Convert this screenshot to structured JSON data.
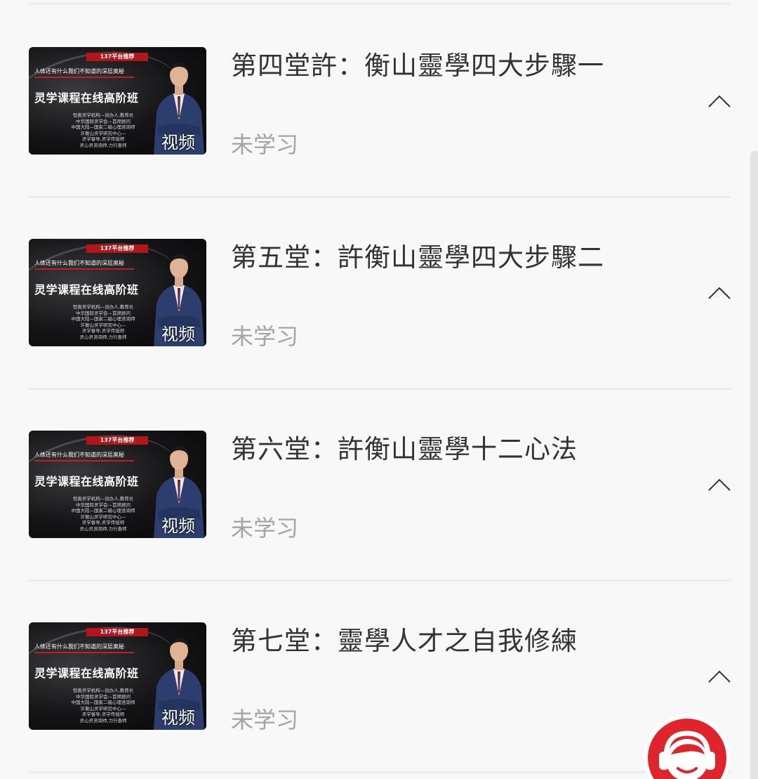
{
  "lessons": [
    {
      "title": "第四堂許：衡山靈學四大步驟一",
      "status": "未学习",
      "thumbnail": {
        "badge": "137平台推荐",
        "tagline": "人体还有什么我们不知道的深层奥秘",
        "heading": "灵学课程在线高阶班",
        "credits": [
          "恒善灵学机构—创办人,教育长",
          "中华国际灵学会—首席顾问",
          "中国大陆—国家二级心理咨询师",
          "许衡山灵学研究中心—",
          "灵学督导,灵学传授师",
          "灵心灵咨询师,力行查师"
        ],
        "media_label": "视频"
      }
    },
    {
      "title": "第五堂：許衡山靈學四大步驟二",
      "status": "未学习",
      "thumbnail": {
        "badge": "137平台推荐",
        "tagline": "人体还有什么我们不知道的深层奥秘",
        "heading": "灵学课程在线高阶班",
        "credits": [
          "恒善灵学机构—创办人,教育长",
          "中华国际灵学会—首席顾问",
          "中国大陆—国家二级心理咨询师",
          "许衡山灵学研究中心—",
          "灵学督导,灵学传授师",
          "灵心灵咨询师,力行查师"
        ],
        "media_label": "视频"
      }
    },
    {
      "title": "第六堂：許衡山靈學十二心法",
      "status": "未学习",
      "thumbnail": {
        "badge": "137平台推荐",
        "tagline": "人体还有什么我们不知道的深层奥秘",
        "heading": "灵学课程在线高阶班",
        "credits": [
          "恒善灵学机构—创办人,教育长",
          "中华国际灵学会—首席顾问",
          "中国大陆—国家二级心理咨询师",
          "许衡山灵学研究中心—",
          "灵学督导,灵学传授师",
          "灵心灵咨询师,力行查师"
        ],
        "media_label": "视频"
      }
    },
    {
      "title": "第七堂：靈學人才之自我修練",
      "status": "未学习",
      "thumbnail": {
        "badge": "137平台推荐",
        "tagline": "人体还有什么我们不知道的深层奥秘",
        "heading": "灵学课程在线高阶班",
        "credits": [
          "恒善灵学机构—创办人,教育长",
          "中华国际灵学会—首席顾问",
          "中国大陆—国家二级心理咨询师",
          "许衡山灵学研究中心—",
          "灵学督导,灵学传授师",
          "灵心灵咨询师,力行查师"
        ],
        "media_label": "视频"
      }
    }
  ],
  "icons": {
    "expand": "chevron-up-icon",
    "support": "customer-service-icon"
  },
  "colors": {
    "background": "#f8f8f9",
    "title_text": "#333333",
    "status_text": "#a4a4a8",
    "divider": "#ececef",
    "support_red": "#e0242b"
  }
}
